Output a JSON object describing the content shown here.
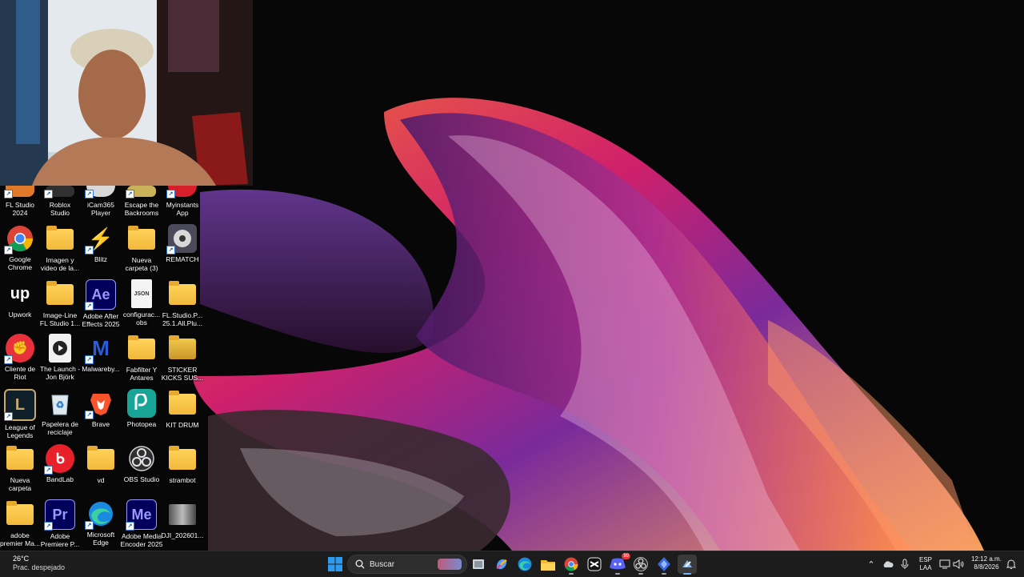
{
  "desktop": {
    "icons": [
      {
        "label": "FL Studio\n2024"
      },
      {
        "label": "Roblox\nStudio"
      },
      {
        "label": "iCam365\nPlayer"
      },
      {
        "label": "Escape the\nBackrooms"
      },
      {
        "label": "Myinstants\nApp"
      },
      {
        "label": "Google\nChrome"
      },
      {
        "label": "Imagen y\nvideo de la..."
      },
      {
        "label": "Blitz"
      },
      {
        "label": "Nueva\ncarpeta (3)"
      },
      {
        "label": "REMATCH"
      },
      {
        "label": "Upwork"
      },
      {
        "label": "Image-Line\nFL Studio 1..."
      },
      {
        "label": "Adobe After\nEffects 2025"
      },
      {
        "label": "configurac...\nobs"
      },
      {
        "label": "FL.Studio.P...\n25.1.All.Plu..."
      },
      {
        "label": "Cliente de\nRiot"
      },
      {
        "label": "The Launch -\nJon Björk"
      },
      {
        "label": "Malwareby..."
      },
      {
        "label": "Fabfilter Y\nAntares"
      },
      {
        "label": "STICKER\nKICKS SUS..."
      },
      {
        "label": "League of\nLegends"
      },
      {
        "label": "Papelera de\nreciclaje"
      },
      {
        "label": "Brave"
      },
      {
        "label": "Photopea"
      },
      {
        "label": "KIT DRUM"
      },
      {
        "label": "Nueva\ncarpeta"
      },
      {
        "label": "BandLab"
      },
      {
        "label": "vd"
      },
      {
        "label": "OBS Studio"
      },
      {
        "label": "strambot"
      },
      {
        "label": "adobe\npremier Ma..."
      },
      {
        "label": "Adobe\nPremiere P..."
      },
      {
        "label": "Microsoft\nEdge"
      },
      {
        "label": "Adobe Media\nEncoder 2025"
      },
      {
        "label": "DJI_202601..."
      }
    ],
    "glyph_text": {
      "upwork": "up",
      "after_effects": "Ae",
      "premiere": "Pr",
      "media_encoder": "Me",
      "json": "JSON"
    }
  },
  "taskbar": {
    "weather": {
      "temp": "26°C",
      "condition": "Prac. despejado"
    },
    "search_placeholder": "Buscar",
    "discord_badge": "99",
    "language": {
      "lang": "ESP",
      "layout": "LAA"
    },
    "clock": {
      "time": "12:12 a.m.",
      "date": "8/8/2026"
    }
  },
  "colors": {
    "taskbar_bg": "#1c1c1c",
    "windows_blue": "#2f9bf0",
    "folder_yellow": "#f2b93b"
  }
}
